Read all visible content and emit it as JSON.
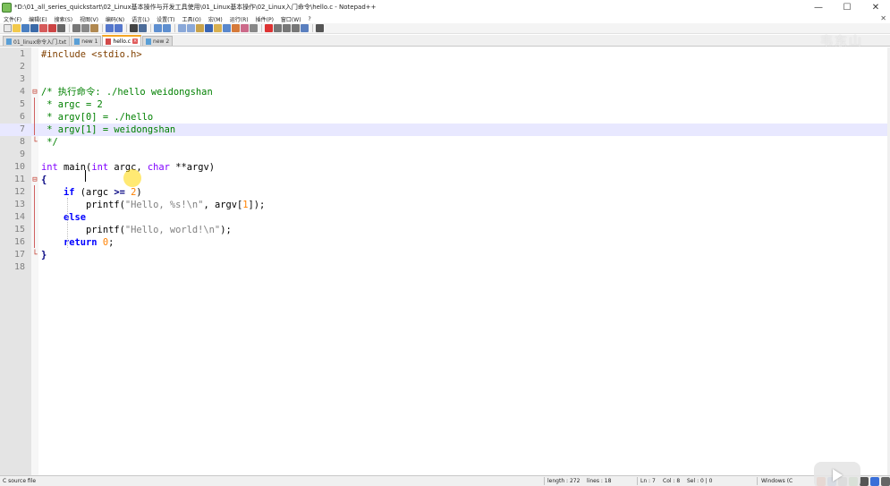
{
  "window": {
    "title": "*D:\\01_all_series_quickstart\\02_Linux基本操作与开发工具使用\\01_Linux基本操作\\02_Linux入门命令\\hello.c - Notepad++",
    "buttons": [
      "—",
      "☐",
      "✕"
    ]
  },
  "menu": [
    "文件(F)",
    "编辑(E)",
    "搜索(S)",
    "视图(V)",
    "编码(N)",
    "语言(L)",
    "设置(T)",
    "工具(O)",
    "宏(M)",
    "运行(R)",
    "插件(P)",
    "窗口(W)",
    "?"
  ],
  "menu_close": "✕",
  "tabs": [
    {
      "label": "01_linux命令入门.txt",
      "active": false
    },
    {
      "label": "new 1",
      "active": false
    },
    {
      "label": "hello.c",
      "active": true
    },
    {
      "label": "new 2",
      "active": false
    }
  ],
  "watermark": "韦东山",
  "editor": {
    "current_line": 7,
    "lines": [
      {
        "n": "1",
        "fold": "",
        "segs": [
          {
            "t": "#include <stdio.h>",
            "c": "c-pre"
          }
        ]
      },
      {
        "n": "2",
        "fold": "",
        "segs": []
      },
      {
        "n": "3",
        "fold": "",
        "segs": []
      },
      {
        "n": "4",
        "fold": "⊟",
        "segs": [
          {
            "t": "/* 执行命令: ./hello weidongshan",
            "c": "c-cmt"
          }
        ]
      },
      {
        "n": "5",
        "fold": "",
        "segs": [
          {
            "t": " * argc = 2",
            "c": "c-cmt"
          }
        ]
      },
      {
        "n": "6",
        "fold": "",
        "segs": [
          {
            "t": " * argv[0] = ./hello",
            "c": "c-cmt"
          }
        ]
      },
      {
        "n": "7",
        "fold": "",
        "segs": [
          {
            "t": " * argv[1] = weidongshan",
            "c": "c-cmt"
          }
        ]
      },
      {
        "n": "8",
        "fold": "└",
        "segs": [
          {
            "t": " */",
            "c": "c-cmt"
          }
        ]
      },
      {
        "n": "9",
        "fold": "",
        "segs": []
      },
      {
        "n": "10",
        "fold": "",
        "segs": [
          {
            "t": "int",
            "c": "c-type"
          },
          {
            "t": " main(",
            "c": ""
          },
          {
            "t": "int",
            "c": "c-type"
          },
          {
            "t": " argc, ",
            "c": ""
          },
          {
            "t": "char",
            "c": "c-type"
          },
          {
            "t": " **argv)",
            "c": ""
          }
        ]
      },
      {
        "n": "11",
        "fold": "⊟",
        "segs": [
          {
            "t": "{",
            "c": "c-op"
          }
        ]
      },
      {
        "n": "12",
        "fold": "",
        "segs": [
          {
            "t": "    ",
            "c": ""
          },
          {
            "t": "if",
            "c": "c-kw"
          },
          {
            "t": " (argc ",
            "c": ""
          },
          {
            "t": ">=",
            "c": "c-op"
          },
          {
            "t": " ",
            "c": ""
          },
          {
            "t": "2",
            "c": "c-num"
          },
          {
            "t": ")",
            "c": ""
          }
        ]
      },
      {
        "n": "13",
        "fold": "",
        "segs": [
          {
            "t": "        printf(",
            "c": ""
          },
          {
            "t": "\"Hello, %s!\\n\"",
            "c": "c-str"
          },
          {
            "t": ", argv[",
            "c": ""
          },
          {
            "t": "1",
            "c": "c-num"
          },
          {
            "t": "]);",
            "c": ""
          }
        ]
      },
      {
        "n": "14",
        "fold": "",
        "segs": [
          {
            "t": "    ",
            "c": ""
          },
          {
            "t": "else",
            "c": "c-kw"
          }
        ]
      },
      {
        "n": "15",
        "fold": "",
        "segs": [
          {
            "t": "        printf(",
            "c": ""
          },
          {
            "t": "\"Hello, world!\\n\"",
            "c": "c-str"
          },
          {
            "t": ");",
            "c": ""
          }
        ]
      },
      {
        "n": "16",
        "fold": "",
        "segs": [
          {
            "t": "    ",
            "c": ""
          },
          {
            "t": "return",
            "c": "c-kw"
          },
          {
            "t": " ",
            "c": ""
          },
          {
            "t": "0",
            "c": "c-num"
          },
          {
            "t": ";",
            "c": ""
          }
        ]
      },
      {
        "n": "17",
        "fold": "└",
        "segs": [
          {
            "t": "}",
            "c": "c-op"
          }
        ]
      },
      {
        "n": "18",
        "fold": "",
        "segs": []
      }
    ]
  },
  "status": {
    "filetype": "C source file",
    "length": "length : 272",
    "lines": "lines : 18",
    "ln": "Ln : 7",
    "col": "Col : 8",
    "sel": "Sel : 0 | 0",
    "eol": "Windows (C"
  },
  "colors": {
    "comment": "#008000",
    "preprocessor": "#804000",
    "keyword": "#0000ff",
    "type": "#8000ff",
    "number": "#ff8000",
    "string": "#808080",
    "current_line": "#e8e8ff",
    "active_tab_accent": "#f5a623"
  }
}
